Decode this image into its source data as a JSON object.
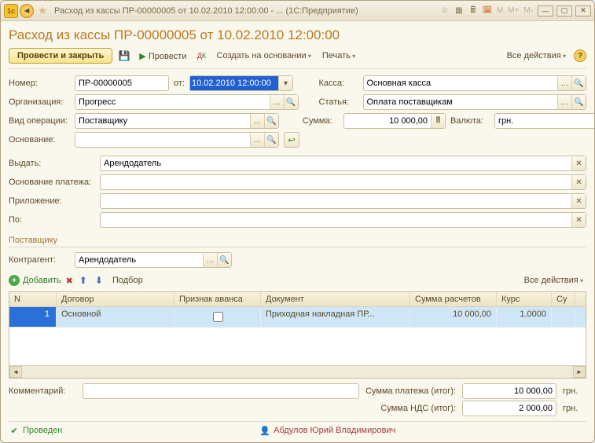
{
  "titlebar": {
    "title": "Расход из кассы ПР-00000005 от 10.02.2010 12:00:00 - ...   (1С:Предприятие)",
    "m_labels": [
      "M",
      "M+",
      "M-"
    ]
  },
  "header": {
    "doc_title": "Расход из кассы ПР-00000005 от 10.02.2010 12:00:00"
  },
  "toolbar": {
    "post_close": "Провести и закрыть",
    "post": "Провести",
    "create_based": "Создать на основании",
    "print": "Печать",
    "all_actions": "Все действия"
  },
  "form": {
    "number_label": "Номер:",
    "number_value": "ПР-00000005",
    "from_label": "от:",
    "date_value": "10.02.2010 12:00:00",
    "kassa_label": "Касса:",
    "kassa_value": "Основная касса",
    "org_label": "Организация:",
    "org_value": "Прогресс",
    "article_label": "Статья:",
    "article_value": "Оплата поставщикам",
    "optype_label": "Вид операции:",
    "optype_value": "Поставщику",
    "sum_label": "Сумма:",
    "sum_value": "10 000,00",
    "currency_label": "Валюта:",
    "currency_value": "грн.",
    "basis_label": "Основание:",
    "basis_value": ""
  },
  "wide": {
    "issue_label": "Выдать:",
    "issue_value": "Арендодатель",
    "payment_basis_label": "Основание платежа:",
    "payment_basis_value": "",
    "attachment_label": "Приложение:",
    "attachment_value": "",
    "po_label": "По:",
    "po_value": ""
  },
  "group": {
    "title": "Поставщику",
    "counterparty_label": "Контрагент:",
    "counterparty_value": "Арендодатель"
  },
  "tabtool": {
    "add": "Добавить",
    "select": "Подбор",
    "all_actions": "Все действия"
  },
  "table": {
    "headers": {
      "n": "N",
      "dogovor": "Договор",
      "avans": "Признак аванса",
      "doc": "Документ",
      "sum": "Сумма расчетов",
      "kurs": "Курс",
      "su": "Су"
    },
    "rows": [
      {
        "n": "1",
        "dogovor": "Основной",
        "avans": false,
        "doc": "Приходная накладная ПР...",
        "sum": "10 000,00",
        "kurs": "1,0000"
      }
    ]
  },
  "footer": {
    "comment_label": "Комментарий:",
    "comment_value": "",
    "paysum_label": "Сумма платежа (итог):",
    "paysum_value": "10 000,00",
    "vat_label": "Сумма НДС (итог):",
    "vat_value": "2 000,00",
    "currency": "грн."
  },
  "status": {
    "posted": "Проведен",
    "user": "Абдулов Юрий Владимирович"
  }
}
